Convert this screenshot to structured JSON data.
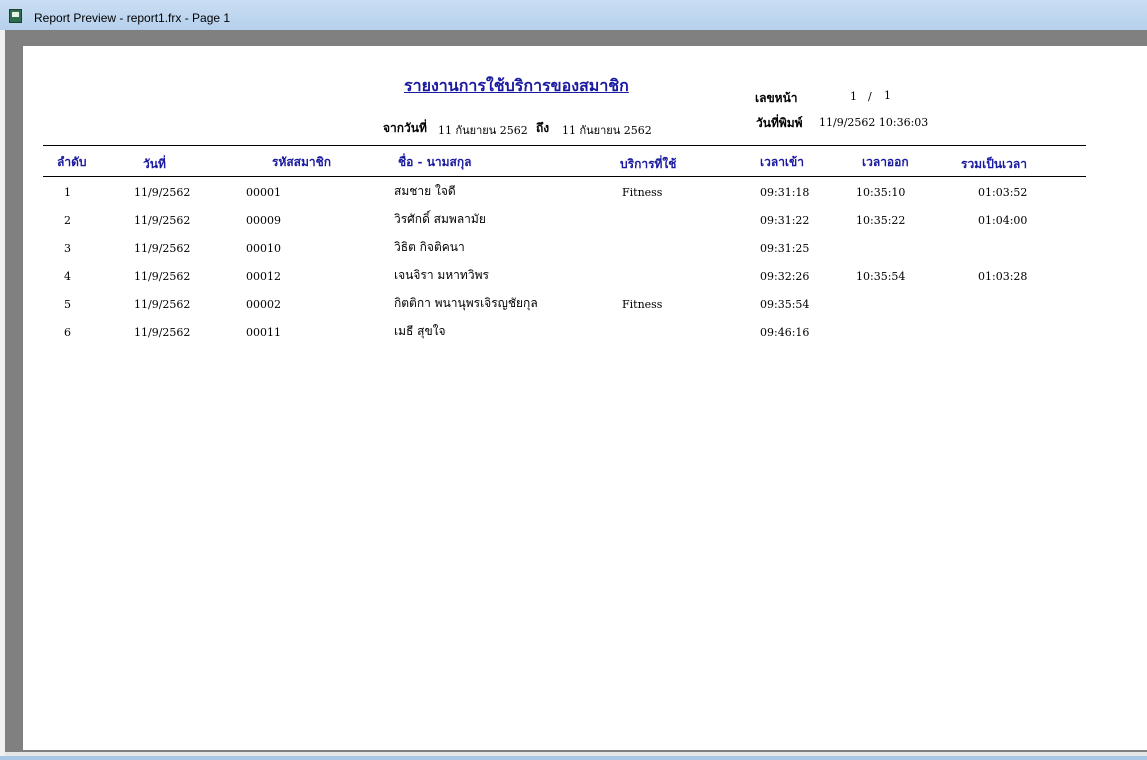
{
  "window": {
    "title": "Report Preview - report1.frx - Page 1",
    "icon": "report-icon"
  },
  "report": {
    "title": "รายงานการใช้บริการของสมาชิก",
    "from_label": "จากวันที่",
    "from_date": "11 กันยายน 2562",
    "to_label": "ถึง",
    "to_date": "11 กันยายน 2562",
    "page_label": "เลขหน้า",
    "page_current": "1",
    "page_sep": "/",
    "page_total": "1",
    "print_label": "วันที่พิมพ์",
    "print_date": "11/9/2562 10:36:03"
  },
  "columns": [
    "ลำดับ",
    "วันที่",
    "รหัสสมาชิก",
    "ชื่อ - นามสกุล",
    "บริการที่ใช้",
    "เวลาเข้า",
    "เวลาออก",
    "รวมเป็นเวลา"
  ],
  "rows": [
    [
      "1",
      "11/9/2562",
      "00001",
      "สมชาย  ใจดี",
      "Fitness",
      "09:31:18",
      "10:35:10",
      "01:03:52"
    ],
    [
      "2",
      "11/9/2562",
      "00009",
      "วิรศักดิ์  สมพลามัย",
      "",
      "09:31:22",
      "10:35:22",
      "01:04:00"
    ],
    [
      "3",
      "11/9/2562",
      "00010",
      "วิธิต  กิจติคนา",
      "",
      "09:31:25",
      "",
      ""
    ],
    [
      "4",
      "11/9/2562",
      "00012",
      "เจนจิรา  มหาทวิพร",
      "",
      "09:32:26",
      "10:35:54",
      "01:03:28"
    ],
    [
      "5",
      "11/9/2562",
      "00002",
      "กิตติกา  พนานุพรเจิรญชัยกุล",
      "Fitness",
      "09:35:54",
      "",
      ""
    ],
    [
      "6",
      "11/9/2562",
      "00011",
      "เมธี  สุขใจ",
      "",
      "09:46:16",
      "",
      ""
    ]
  ]
}
